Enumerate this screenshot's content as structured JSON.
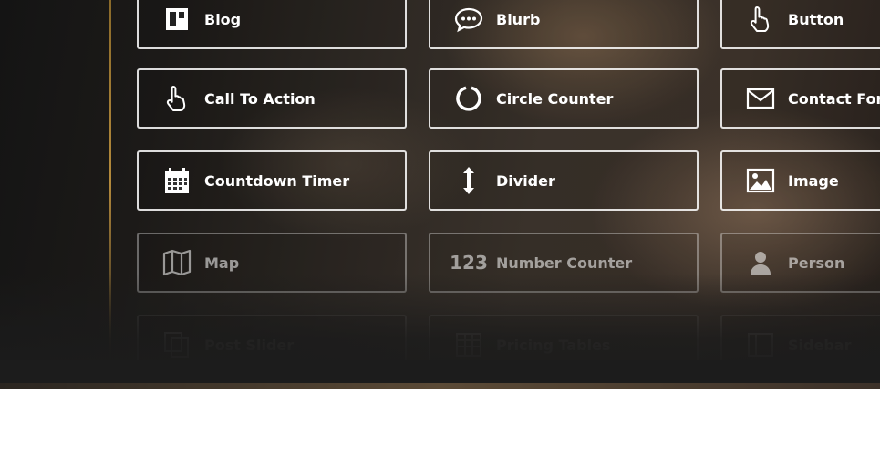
{
  "modules": {
    "blog": {
      "label": "Blog",
      "icon": "blog-icon"
    },
    "blurb": {
      "label": "Blurb",
      "icon": "speech-bubble-icon"
    },
    "button": {
      "label": "Button",
      "icon": "pointer-hand-icon"
    },
    "call_to_action": {
      "label": "Call To Action",
      "icon": "pointer-hand-icon"
    },
    "circle_counter": {
      "label": "Circle Counter",
      "icon": "circle-counter-icon"
    },
    "contact_form": {
      "label": "Contact Form",
      "icon": "envelope-icon"
    },
    "countdown_timer": {
      "label": "Countdown Timer",
      "icon": "calendar-icon"
    },
    "divider": {
      "label": "Divider",
      "icon": "vertical-arrows-icon"
    },
    "image": {
      "label": "Image",
      "icon": "image-icon"
    },
    "map": {
      "label": "Map",
      "icon": "map-icon"
    },
    "number_counter": {
      "label": "Number Counter",
      "icon": "number-icon",
      "icon_text": "123"
    },
    "person": {
      "label": "Person",
      "icon": "person-icon"
    },
    "post_slider": {
      "label": "Post Slider",
      "icon": "copy-icon"
    },
    "pricing_tables": {
      "label": "Pricing Tables",
      "icon": "table-icon"
    },
    "sidebar": {
      "label": "Sidebar",
      "icon": "sidebar-icon"
    }
  }
}
